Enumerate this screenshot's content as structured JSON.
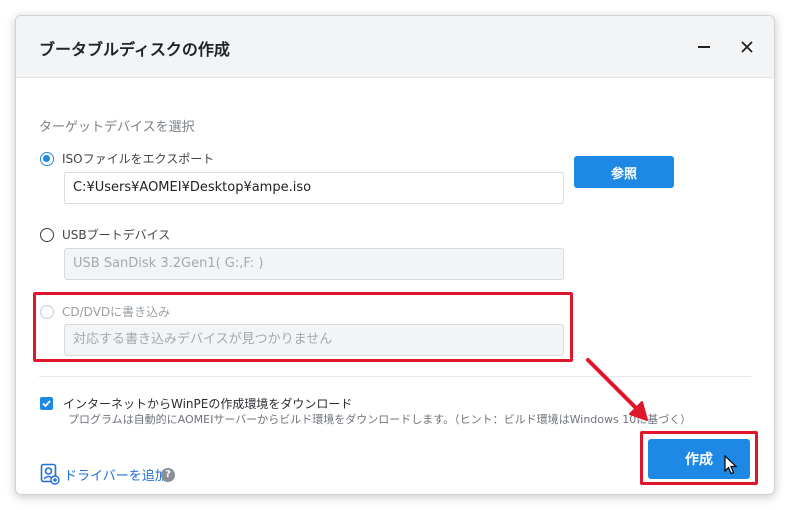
{
  "dialog": {
    "title": "ブータブルディスクの作成"
  },
  "target": {
    "section_label": "ターゲットデバイスを選択",
    "iso": {
      "label": "ISOファイルをエクスポート",
      "path_value": "C:¥Users¥AOMEI¥Desktop¥ampe.iso",
      "browse_label": "参照"
    },
    "usb": {
      "label": "USBブートデバイス",
      "device_value": "USB SanDisk 3.2Gen1( G:,F: )"
    },
    "cd": {
      "label": "CD/DVDに書き込み",
      "placeholder": "対応する書き込みデバイスが見つかりません"
    }
  },
  "download": {
    "label": "インターネットからWinPEの作成環境をダウンロード",
    "description": "プログラムは自動的にAOMEIサーバーからビルド環境をダウンロードします。（ヒント：ビルド環境はWindows 10に基づく）"
  },
  "footer": {
    "add_driver_label": "ドライバーを追加",
    "help_glyph": "?",
    "create_label": "作成"
  },
  "colors": {
    "accent": "#1e88e5",
    "highlight": "#e0162b"
  }
}
